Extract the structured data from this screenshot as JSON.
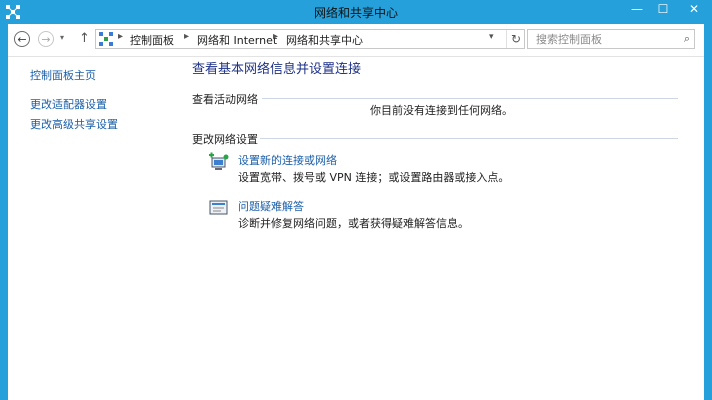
{
  "window": {
    "title": "网络和共享中心",
    "minimize": "—",
    "maximize": "☐",
    "close": "✕"
  },
  "navigation": {
    "back": "←",
    "forward": "→",
    "history": "▾",
    "up": "↑",
    "breadcrumb_sep": "▸",
    "breadcrumbs": [
      "控制面板",
      "网络和 Internet",
      "网络和共享中心"
    ],
    "dropdown": "▾",
    "refresh": "↻",
    "search_placeholder": "搜索控制面板",
    "search_icon": "⌕"
  },
  "sidebar": {
    "items": [
      {
        "label": "控制面板主页"
      },
      {
        "label": "更改适配器设置"
      },
      {
        "label": "更改高级共享设置"
      }
    ]
  },
  "main": {
    "title": "查看基本网络信息并设置连接",
    "active_networks_heading": "查看活动网络",
    "no_network_text": "你目前没有连接到任何网络。",
    "change_settings_heading": "更改网络设置",
    "tasks": [
      {
        "icon": "network-setup-icon",
        "link": "设置新的连接或网络",
        "description": "设置宽带、拨号或 VPN 连接；或设置路由器或接入点。"
      },
      {
        "icon": "troubleshoot-icon",
        "link": "问题疑难解答",
        "description": "诊断并修复网络问题，或者获得疑难解答信息。"
      }
    ]
  },
  "colors": {
    "title_bar": "#26a0da",
    "link": "#1a5fa8",
    "page_title": "#1e3287"
  }
}
